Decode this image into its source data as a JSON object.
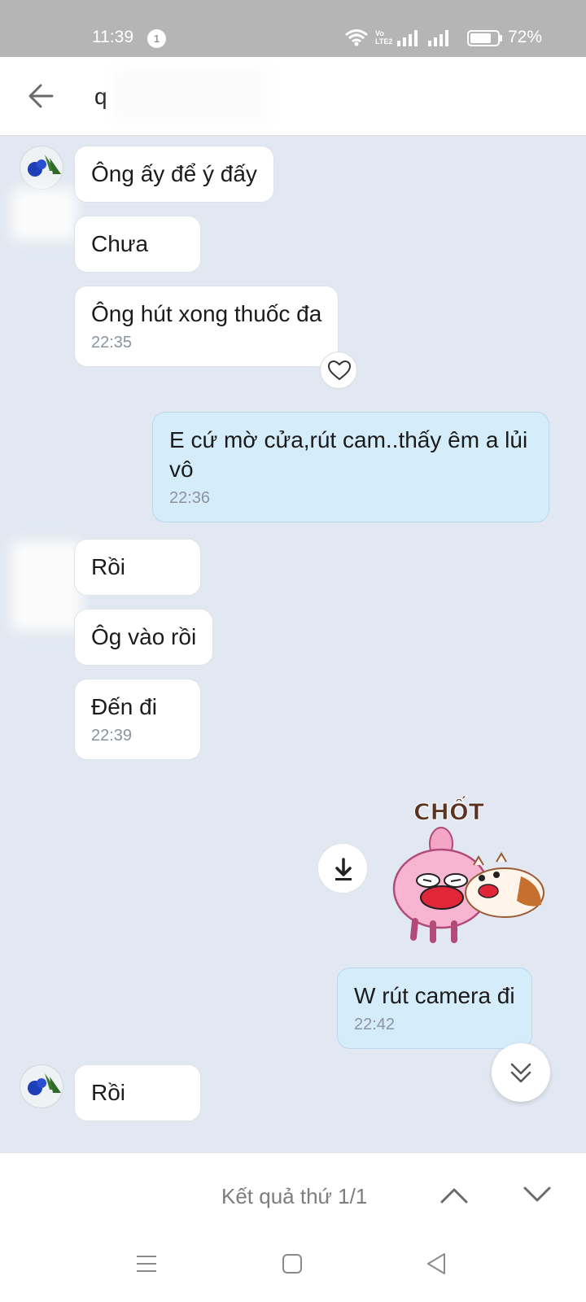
{
  "status_bar": {
    "time": "11:39",
    "notification_count": "1",
    "volte": "Vo LTE2",
    "battery": "72%"
  },
  "header": {
    "search_value": "q",
    "back_icon": "arrow-left-icon"
  },
  "messages": [
    {
      "direction": "in",
      "text": "Ông ấy để ý đấy",
      "time": ""
    },
    {
      "direction": "in",
      "text": "Chưa",
      "time": ""
    },
    {
      "direction": "in",
      "text": "Ông hút xong thuốc đa",
      "time": "22:35"
    },
    {
      "direction": "out",
      "text": "E cứ mờ cửa,rút cam..thấy êm a lủi vô",
      "time": "22:36"
    },
    {
      "direction": "in",
      "text": "Rồi",
      "time": ""
    },
    {
      "direction": "in",
      "text": "Ôg vào rồi",
      "time": ""
    },
    {
      "direction": "in",
      "text": "Đến đi",
      "time": "22:39"
    },
    {
      "direction": "out",
      "type": "sticker",
      "text": "CHỐT",
      "time": ""
    },
    {
      "direction": "out",
      "text": "W rút camera đi",
      "time": "22:42"
    },
    {
      "direction": "in",
      "text": "Rồi",
      "time": ""
    }
  ],
  "search_results": {
    "label": "Kết quả thứ 1/1"
  },
  "colors": {
    "chat_background": "#e1e8f1",
    "incoming_bubble": "#ffffff",
    "outgoing_bubble": "#d5ecfb",
    "status_bar": "#b5b5b5"
  }
}
